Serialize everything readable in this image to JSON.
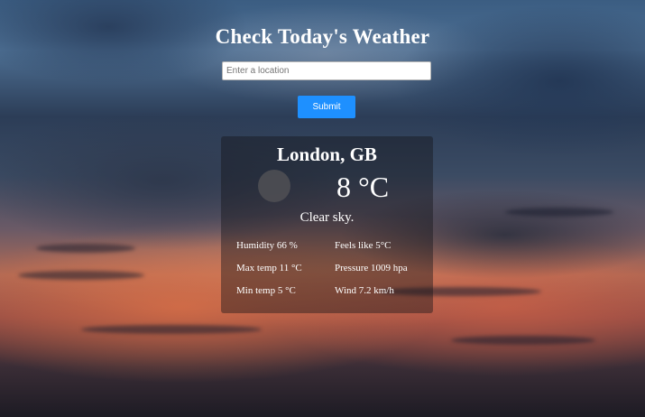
{
  "header": {
    "title": "Check Today's Weather"
  },
  "search": {
    "placeholder": "Enter a location",
    "value": "",
    "submit_label": "Submit"
  },
  "weather": {
    "city": "London, GB",
    "temperature": "8 °C",
    "description": "Clear sky.",
    "details": {
      "humidity": "Humidity 66 %",
      "feels_like": "Feels like 5°C",
      "max_temp": "Max temp 11 °C",
      "pressure": "Pressure 1009 hpa",
      "min_temp": "Min temp 5 °C",
      "wind": "Wind 7.2 km/h"
    },
    "icon": "weather-condition-icon"
  },
  "colors": {
    "accent": "#1e90ff",
    "text": "#ffffff",
    "card_background": "rgba(20,20,25,0.42)"
  }
}
